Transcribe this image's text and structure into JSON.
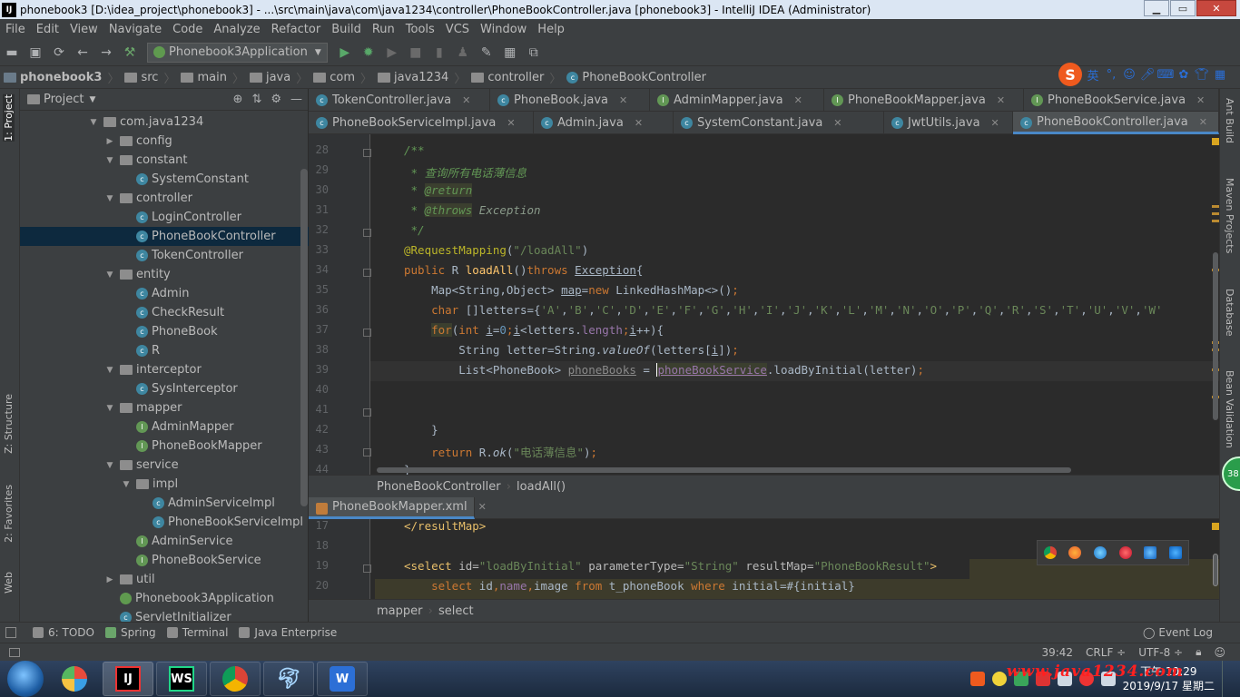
{
  "window": {
    "title": "phonebook3 [D:\\idea_project\\phonebook3] - ...\\src\\main\\java\\com\\java1234\\controller\\PhoneBookController.java [phonebook3] - IntelliJ IDEA (Administrator)",
    "min": "▁",
    "max": "▭",
    "close": "✕"
  },
  "menu": [
    "File",
    "Edit",
    "View",
    "Navigate",
    "Code",
    "Analyze",
    "Refactor",
    "Build",
    "Run",
    "Tools",
    "VCS",
    "Window",
    "Help"
  ],
  "toolbar": {
    "run_config": "Phonebook3Application"
  },
  "breadcrumb": [
    "phonebook3",
    "src",
    "main",
    "java",
    "com",
    "java1234",
    "controller",
    "PhoneBookController"
  ],
  "ime": {
    "lang": "英",
    "punct": "°,"
  },
  "left_tabs": {
    "project": "1: Project",
    "structure": "Z: Structure",
    "favorites": "2: Favorites",
    "web": "Web"
  },
  "right_tabs": {
    "ant": "Ant Build",
    "maven": "Maven Projects",
    "database": "Database",
    "bean": "Bean Validation"
  },
  "project": {
    "header": "Project",
    "tree": [
      {
        "label": "com.java1234",
        "type": "pkg",
        "depth": 0,
        "open": true
      },
      {
        "label": "config",
        "type": "pkg",
        "depth": 1,
        "open": false
      },
      {
        "label": "constant",
        "type": "pkg",
        "depth": 1,
        "open": true
      },
      {
        "label": "SystemConstant",
        "type": "class",
        "depth": 2
      },
      {
        "label": "controller",
        "type": "pkg",
        "depth": 1,
        "open": true
      },
      {
        "label": "LoginController",
        "type": "class",
        "depth": 2
      },
      {
        "label": "PhoneBookController",
        "type": "class",
        "depth": 2,
        "selected": true
      },
      {
        "label": "TokenController",
        "type": "class",
        "depth": 2
      },
      {
        "label": "entity",
        "type": "pkg",
        "depth": 1,
        "open": true
      },
      {
        "label": "Admin",
        "type": "class",
        "depth": 2
      },
      {
        "label": "CheckResult",
        "type": "class",
        "depth": 2
      },
      {
        "label": "PhoneBook",
        "type": "class",
        "depth": 2
      },
      {
        "label": "R",
        "type": "class",
        "depth": 2
      },
      {
        "label": "interceptor",
        "type": "pkg",
        "depth": 1,
        "open": true
      },
      {
        "label": "SysInterceptor",
        "type": "class",
        "depth": 2
      },
      {
        "label": "mapper",
        "type": "pkg",
        "depth": 1,
        "open": true
      },
      {
        "label": "AdminMapper",
        "type": "interface",
        "depth": 2
      },
      {
        "label": "PhoneBookMapper",
        "type": "interface",
        "depth": 2
      },
      {
        "label": "service",
        "type": "pkg",
        "depth": 1,
        "open": true
      },
      {
        "label": "impl",
        "type": "pkg",
        "depth": 2,
        "open": true
      },
      {
        "label": "AdminServiceImpl",
        "type": "class",
        "depth": 3
      },
      {
        "label": "PhoneBookServiceImpl",
        "type": "class",
        "depth": 3
      },
      {
        "label": "AdminService",
        "type": "interface",
        "depth": 2
      },
      {
        "label": "PhoneBookService",
        "type": "interface",
        "depth": 2
      },
      {
        "label": "util",
        "type": "pkg",
        "depth": 1,
        "open": false
      },
      {
        "label": "Phonebook3Application",
        "type": "app",
        "depth": 1
      },
      {
        "label": "ServletInitializer",
        "type": "class",
        "depth": 1
      }
    ]
  },
  "tabs_row1": [
    {
      "label": "TokenController.java",
      "kind": "class"
    },
    {
      "label": "PhoneBook.java",
      "kind": "class"
    },
    {
      "label": "AdminMapper.java",
      "kind": "interface"
    },
    {
      "label": "PhoneBookMapper.java",
      "kind": "interface"
    },
    {
      "label": "PhoneBookService.java",
      "kind": "interface"
    }
  ],
  "tabs_row2": [
    {
      "label": "PhoneBookServiceImpl.java",
      "kind": "class"
    },
    {
      "label": "Admin.java",
      "kind": "class"
    },
    {
      "label": "SystemConstant.java",
      "kind": "class"
    },
    {
      "label": "JwtUtils.java",
      "kind": "class"
    },
    {
      "label": "PhoneBookController.java",
      "kind": "class",
      "active": true
    }
  ],
  "editor": {
    "line_numbers": [
      "28",
      "29",
      "30",
      "31",
      "32",
      "33",
      "34",
      "35",
      "36",
      "37",
      "38",
      "39",
      "40",
      "41",
      "42",
      "43",
      "44"
    ],
    "breadcrumb": [
      "PhoneBookController",
      "loadAll()"
    ]
  },
  "xml": {
    "tab": "PhoneBookMapper.xml",
    "line_numbers": [
      "17",
      "18",
      "19",
      "20"
    ],
    "breadcrumb": [
      "mapper",
      "select"
    ]
  },
  "tool_windows": [
    "6: TODO",
    "Spring",
    "Terminal",
    "Java Enterprise"
  ],
  "event_log": "Event Log",
  "status": {
    "position": "39:42",
    "line_sep": "CRLF ÷",
    "encoding": "UTF-8 ÷"
  },
  "taskbar": {
    "apps": [
      "IJ",
      "WS",
      "",
      "",
      "W"
    ],
    "time": "下午 10:29",
    "date": "2019/9/17 星期二",
    "watermark": "www.java1234.com"
  },
  "badge": "38"
}
